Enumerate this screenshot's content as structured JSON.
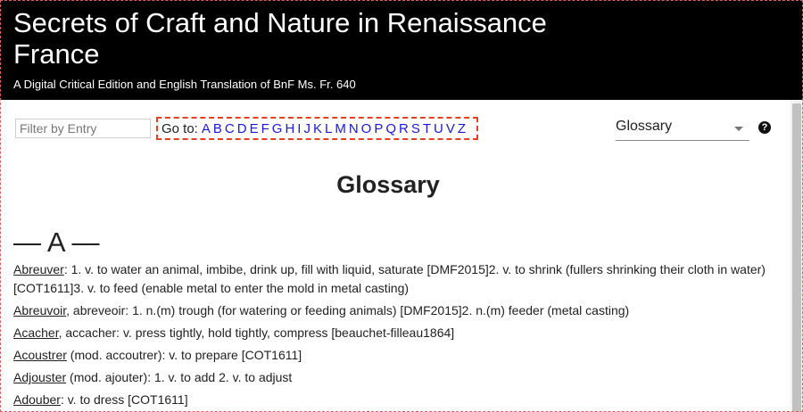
{
  "header": {
    "title": "Secrets of Craft and Nature in Renaissance France",
    "subtitle": "A Digital Critical Edition and English Translation of BnF Ms. Fr. 640"
  },
  "toolbar": {
    "filter_placeholder": "Filter by Entry",
    "goto_label": "Go to:",
    "letters": [
      "A",
      "B",
      "C",
      "D",
      "E",
      "F",
      "G",
      "H",
      "I",
      "J",
      "K",
      "L",
      "M",
      "N",
      "O",
      "P",
      "Q",
      "R",
      "S",
      "T",
      "U",
      "V",
      "Z"
    ],
    "view_select": {
      "selected": "Glossary"
    },
    "help_icon": "question-circle-icon"
  },
  "main": {
    "page_title": "Glossary",
    "letter_heading": "— A —",
    "entries": [
      {
        "term": "Abreuver",
        "text": ": 1. v. to water an animal, imbibe, drink up, fill with liquid, saturate [DMF2015]2. v. to shrink (fullers shrinking their cloth in water) [COT1611]3. v. to feed (enable metal to enter the mold in metal casting)"
      },
      {
        "term": "Abreuvoir",
        "text": ", abreveoir: 1. n.(m) trough (for watering or feeding animals) [DMF2015]2. n.(m) feeder (metal casting)"
      },
      {
        "term": "Acacher",
        "text": ", accacher: v. press tightly, hold tightly, compress [beauchet-filleau1864]"
      },
      {
        "term": "Acoustrer",
        "text": " (mod. accoutrer): v. to prepare [COT1611]"
      },
      {
        "term": "Adjouster",
        "text": " (mod. ajouter): 1. v. to add 2. v. to adjust"
      },
      {
        "term": "Adouber",
        "text": ": v. to dress [COT1611]"
      }
    ]
  },
  "colors": {
    "header_bg": "#000000",
    "link": "#1a1adc",
    "highlight_border": "#e8401c"
  }
}
